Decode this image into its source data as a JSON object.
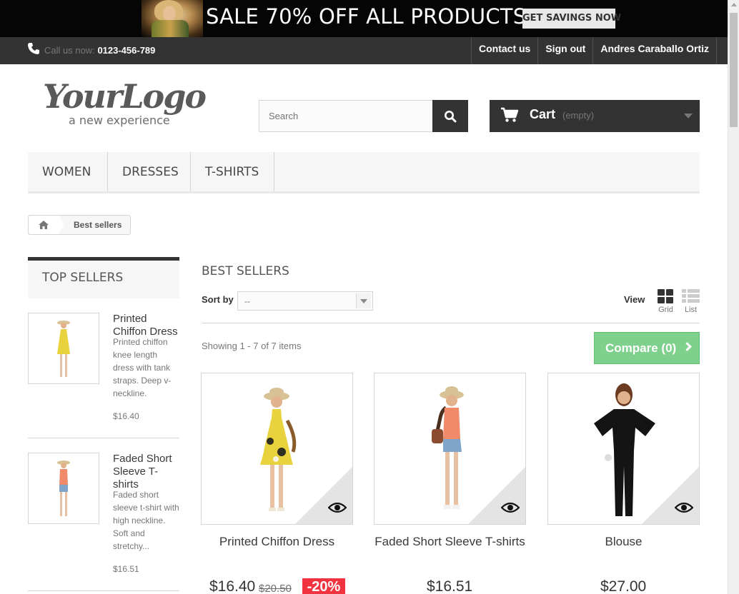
{
  "banner": {
    "text": "SALE 70% OFF ALL PRODUCTS",
    "button": "GET SAVINGS NOW"
  },
  "topbar": {
    "phone_prefix": "Call us now:",
    "phone_number": "0123-456-789",
    "links": [
      "Contact us",
      "Sign out",
      "Andres Caraballo Ortiz"
    ]
  },
  "logo": {
    "main": "YourLogo",
    "tagline": "a new experience"
  },
  "search": {
    "placeholder": "Search"
  },
  "cart": {
    "label": "Cart",
    "status": "(empty)"
  },
  "menu": {
    "items": [
      "WOMEN",
      "DRESSES",
      "T-SHIRTS"
    ]
  },
  "breadcrumb": {
    "current": "Best sellers"
  },
  "sidebar": {
    "title": "TOP SELLERS",
    "items": [
      {
        "name": "Printed Chiffon Dress",
        "description": "Printed chiffon knee length dress with tank straps. Deep v-neckline.",
        "price": "$16.40"
      },
      {
        "name": "Faded Short Sleeve T-shirts",
        "description": "Faded short sleeve t-shirt with high neckline. Soft and stretchy...",
        "price": "$16.51"
      }
    ]
  },
  "main": {
    "heading": "BEST SELLERS",
    "sort_label": "Sort by",
    "sort_value": "--",
    "view_label": "View",
    "view_grid": "Grid",
    "view_list": "List",
    "showing": "Showing 1 - 7 of 7 items",
    "compare": "Compare (0)"
  },
  "products": [
    {
      "name": "Printed Chiffon Dress",
      "price": "$16.40",
      "old_price": "$20.50",
      "discount": "-20%"
    },
    {
      "name": "Faded Short Sleeve T-shirts",
      "price": "$16.51"
    },
    {
      "name": "Blouse",
      "price": "$27.00"
    }
  ],
  "colors": {
    "dark": "#333333",
    "compare_green": "#7fcf8d",
    "discount_red": "#f13340"
  }
}
